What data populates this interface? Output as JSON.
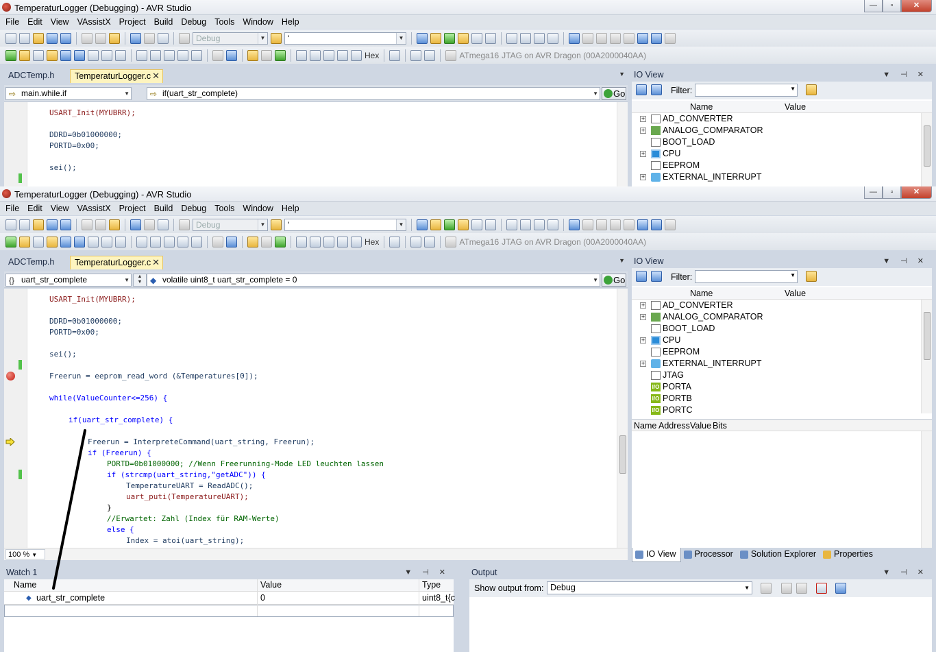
{
  "window_title": "TemperaturLogger (Debugging) - AVR Studio",
  "window_buttons": {
    "minimize": "—",
    "maximize": "▫",
    "close": "✕"
  },
  "menu": [
    "File",
    "Edit",
    "View",
    "VAssistX",
    "Project",
    "Build",
    "Debug",
    "Tools",
    "Window",
    "Help"
  ],
  "toolbar": {
    "config": "Debug",
    "search": "'",
    "hex": "Hex",
    "device": "ATmega16",
    "tool": "JTAG on AVR Dragon (00A2000040AA)"
  },
  "tabs": {
    "inactive": "ADCTemp.h",
    "active": "TemperaturLogger.c",
    "close": "✕"
  },
  "nav_top": {
    "scope": "main.while.if",
    "member": "if(uart_str_complete)",
    "go": "Go"
  },
  "nav_bottom": {
    "scope": "uart_str_complete",
    "member": "volatile uint8_t uart_str_complete = 0",
    "go": "Go"
  },
  "code_top": [
    "USART_Init(MYUBRR);",
    "DDRD=0b01000000;",
    "PORTD=0x00;",
    "sei();"
  ],
  "code_bottom": [
    "USART_Init(MYUBRR);",
    "DDRD=0b01000000;",
    "PORTD=0x00;",
    "sei();",
    "Freerun = eeprom_read_word (&Temperatures[0]);",
    "while(ValueCounter<=256) {",
    "if(uart_str_complete) {",
    "Freerun = InterpreteCommand(uart_string, Freerun);",
    "if (Freerun) {",
    "PORTD=0b01000000; //Wenn Freerunning-Mode LED leuchten lassen",
    "if (strcmp(uart_string,\"getADC\")) {",
    "TemperatureUART = ReadADC();",
    "uart_puti(TemperatureUART);",
    "}",
    "//Erwartet: Zahl (Index für RAM-Werte)",
    "else {",
    "Index = atoi(uart_string);"
  ],
  "zoom": "100 %",
  "io_view": {
    "title": "IO View",
    "filter_label": "Filter:",
    "col_name": "Name",
    "col_value": "Value",
    "items_top": [
      "AD_CONVERTER",
      "ANALOG_COMPARATOR",
      "BOOT_LOAD",
      "CPU",
      "EEPROM",
      "EXTERNAL_INTERRUPT"
    ],
    "items_bottom": [
      "AD_CONVERTER",
      "ANALOG_COMPARATOR",
      "BOOT_LOAD",
      "CPU",
      "EEPROM",
      "EXTERNAL_INTERRUPT",
      "JTAG",
      "PORTA",
      "PORTB",
      "PORTC"
    ],
    "detail_cols": [
      "Name",
      "Address",
      "Value",
      "Bits"
    ]
  },
  "bottom_tabs": [
    "IO View",
    "Processor",
    "Solution Explorer",
    "Properties"
  ],
  "watch": {
    "title": "Watch 1",
    "col_name": "Name",
    "col_value": "Value",
    "col_type": "Type",
    "row_name": "uart_str_complete",
    "row_value": "0",
    "row_type": "uint8_t{c"
  },
  "output": {
    "title": "Output",
    "show_label": "Show output from:",
    "source": "Debug"
  }
}
